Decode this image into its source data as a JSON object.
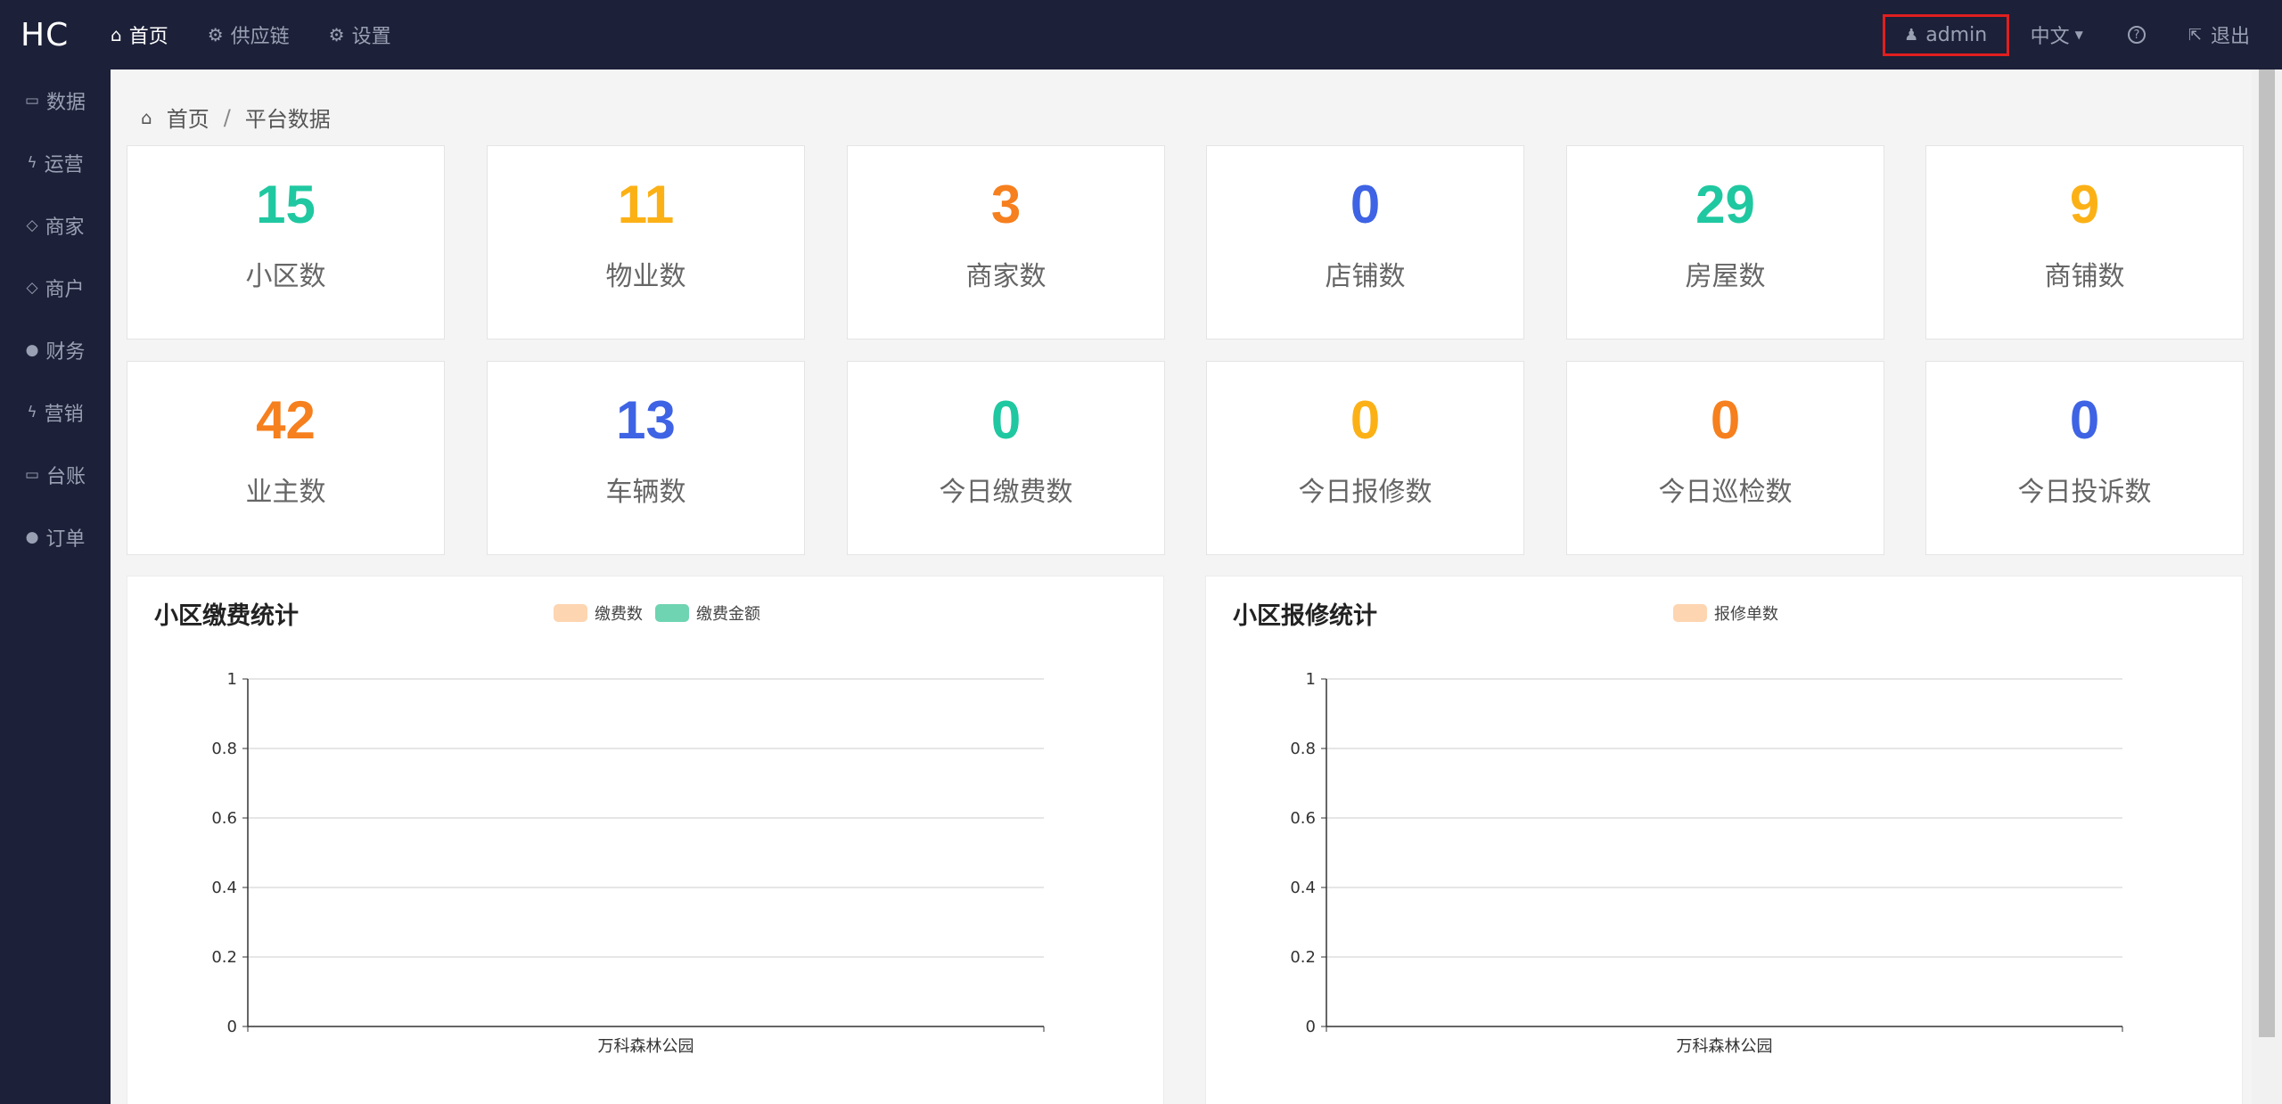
{
  "brand": "HC",
  "topnav": [
    {
      "label": "首页",
      "icon": "home-icon",
      "glyph": "⌂",
      "active": true
    },
    {
      "label": "供应链",
      "icon": "gear-icon",
      "glyph": "⚙",
      "active": false
    },
    {
      "label": "设置",
      "icon": "gear-icon",
      "glyph": "⚙",
      "active": false
    }
  ],
  "user": {
    "name": "admin",
    "highlight_color": "#e01f1f"
  },
  "language": "中文",
  "help_glyph": "?",
  "logout": "退出",
  "sidebar": [
    {
      "label": "数据",
      "icon": "laptop-icon",
      "glyph": "▭"
    },
    {
      "label": "运营",
      "icon": "bolt-icon",
      "glyph": "ϟ"
    },
    {
      "label": "商家",
      "icon": "diamond-icon",
      "glyph": "◇"
    },
    {
      "label": "商户",
      "icon": "diamond-icon",
      "glyph": "◇"
    },
    {
      "label": "财务",
      "icon": "globe-icon",
      "glyph": "●"
    },
    {
      "label": "营销",
      "icon": "bolt-icon",
      "glyph": "ϟ"
    },
    {
      "label": "台账",
      "icon": "laptop-icon",
      "glyph": "▭"
    },
    {
      "label": "订单",
      "icon": "globe-icon",
      "glyph": "●"
    }
  ],
  "breadcrumb": {
    "home": "首页",
    "separator": "/",
    "current": "平台数据"
  },
  "stats": [
    {
      "value": "15",
      "label": "小区数",
      "color": "#1fc8a0"
    },
    {
      "value": "11",
      "label": "物业数",
      "color": "#fbb116"
    },
    {
      "value": "3",
      "label": "商家数",
      "color": "#f67f1e"
    },
    {
      "value": "0",
      "label": "店铺数",
      "color": "#3e63e4"
    },
    {
      "value": "29",
      "label": "房屋数",
      "color": "#1fc8a0"
    },
    {
      "value": "9",
      "label": "商铺数",
      "color": "#fbb116"
    },
    {
      "value": "42",
      "label": "业主数",
      "color": "#f67f1e"
    },
    {
      "value": "13",
      "label": "车辆数",
      "color": "#3e63e4"
    },
    {
      "value": "0",
      "label": "今日缴费数",
      "color": "#1fc8a0"
    },
    {
      "value": "0",
      "label": "今日报修数",
      "color": "#fbb116"
    },
    {
      "value": "0",
      "label": "今日巡检数",
      "color": "#f67f1e"
    },
    {
      "value": "0",
      "label": "今日投诉数",
      "color": "#3e63e4"
    }
  ],
  "chart_data": [
    {
      "type": "bar",
      "title": "小区缴费统计",
      "categories": [
        "万科森林公园"
      ],
      "series": [
        {
          "name": "缴费数",
          "values": [
            0
          ],
          "color": "#fdd5b1"
        },
        {
          "name": "缴费金额",
          "values": [
            0
          ],
          "color": "#6fd4b1"
        }
      ],
      "ylim": [
        0,
        1
      ],
      "yticks": [
        "0",
        "0.2",
        "0.4",
        "0.6",
        "0.8",
        "1"
      ],
      "grid": true,
      "legend_position": "top-center"
    },
    {
      "type": "bar",
      "title": "小区报修统计",
      "categories": [
        "万科森林公园"
      ],
      "series": [
        {
          "name": "报修单数",
          "values": [
            0
          ],
          "color": "#fdd5b1"
        }
      ],
      "ylim": [
        0,
        1
      ],
      "yticks": [
        "0",
        "0.2",
        "0.4",
        "0.6",
        "0.8",
        "1"
      ],
      "grid": true,
      "legend_position": "top-center"
    }
  ]
}
